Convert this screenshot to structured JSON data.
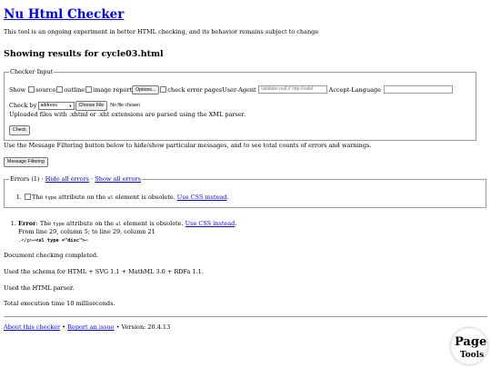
{
  "header": {
    "title": "Nu Html Checker",
    "subtitle": "This tool is an ongoing experiment in better HTML checking, and its behavior remains subject to change"
  },
  "results_heading": "Showing results for cycle03.html",
  "checker_input": {
    "legend": "Checker Input",
    "show_label": "Show",
    "source_label": "source",
    "outline_label": "outline",
    "image_report_label": "image report",
    "options_button": "Options...",
    "check_error_pages_label": "check error pages",
    "user_agent_label": "User-Agent",
    "user_agent_value": "Validator.nu/LV http://valid",
    "accept_language_label": "Accept-Language",
    "accept_language_value": "",
    "check_by_label": "Check by",
    "check_by_value": "address",
    "choose_file_button": "Choose File",
    "no_file_text": "No file chosen",
    "upload_note": "Uploaded files with .xhtml or .xht extensions are parsed using the XML parser.",
    "check_button": "Check"
  },
  "filter": {
    "help_text": "Use the Message Filtering button below to hide/show particular messages, and to see total counts of errors and warnings.",
    "button_label": "Message Filtering"
  },
  "errors_box": {
    "legend_count": "Errors (1)",
    "sep1": " · ",
    "hide_all": "Hide all errors",
    "sep2": " · ",
    "show_all": "Show all errors",
    "item": {
      "text_the": "The",
      "code_type": "type",
      "text_mid": "attribute on the",
      "code_ul": "ul",
      "text_end": "element is obsolete.",
      "link": "Use CSS instead"
    }
  },
  "result_message": {
    "prefix": "Error",
    "colon": ":",
    "text_the": "The",
    "code_type": "type",
    "text_mid": "attribute on the",
    "code_ul": "ul",
    "text_end": "element is obsolete.",
    "link": "Use CSS instead",
    "location": "From line 29, column 5; to line 29, column 21",
    "extract_pre": ".</p>↩",
    "extract_highlight": "<ul type =\"disc\">",
    "extract_post": "↩"
  },
  "status": {
    "completed": "Document checking completed.",
    "schema": "Used the schema for HTML + SVG 1.1 + MathML 3.0 + RDFa 1.1.",
    "parser": "Used the HTML parser.",
    "time": "Total execution time 10 milliseconds."
  },
  "footer": {
    "about": "About this checker",
    "sep1": " • ",
    "report": "Report an issue",
    "version": " • Version: 20.4.13"
  },
  "page_badge": {
    "line1": "Page",
    "line2": "Tools"
  }
}
